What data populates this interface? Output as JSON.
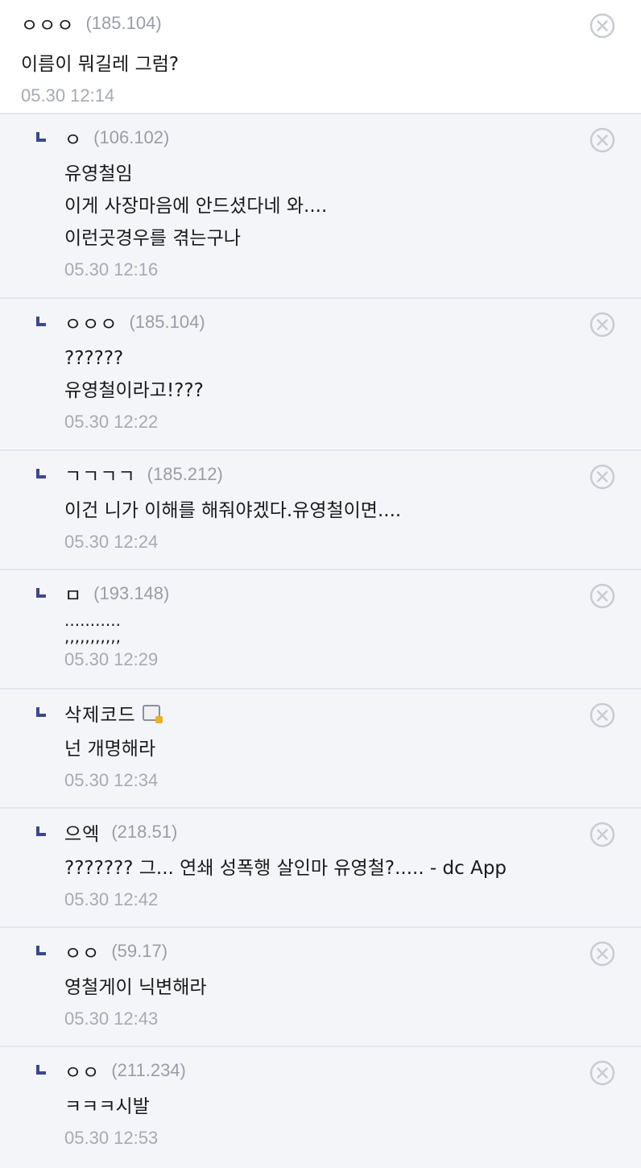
{
  "comments": [
    {
      "nick": "ㅇㅇㅇ",
      "ip": "(185.104)",
      "body": "이름이 뭐길레 그럼?",
      "date": "05.30 12:14",
      "reply": false
    },
    {
      "nick": "ㅇ",
      "ip": "(106.102)",
      "body": "유영철임\n이게 사장마음에 안드셨다네 와....\n이런곳경우를 겪는구나",
      "date": "05.30 12:16",
      "reply": true
    },
    {
      "nick": "ㅇㅇㅇ",
      "ip": "(185.104)",
      "body": "??????\n유영철이라고!???",
      "date": "05.30 12:22",
      "reply": true
    },
    {
      "nick": "ㄱㄱㄱㄱ",
      "ip": "(185.212)",
      "body": "이건 니가 이해를 해줘야겠다.유영철이면....",
      "date": "05.30 12:24",
      "reply": true
    },
    {
      "nick": "ㅁ",
      "ip": "(193.148)",
      "body": "...........\n,,,,,,,,,,,",
      "date": "05.30 12:29",
      "reply": true
    },
    {
      "nick": "삭제코드",
      "ip": "",
      "body": "넌 개명해라",
      "date": "05.30 12:34",
      "reply": true,
      "badge": true
    },
    {
      "nick": "으엑",
      "ip": "(218.51)",
      "body": "??????? 그... 연쇄 성폭행 살인마 유영철?..... - dc App",
      "date": "05.30 12:42",
      "reply": true
    },
    {
      "nick": "ㅇㅇ",
      "ip": "(59.17)",
      "body": "영철게이 닉변해라",
      "date": "05.30 12:43",
      "reply": true
    },
    {
      "nick": "ㅇㅇ",
      "ip": "(211.234)",
      "body": "ㅋㅋㅋ시발",
      "date": "05.30 12:53",
      "reply": true
    }
  ],
  "icons": {
    "delete": "close-circle-icon",
    "reply": "reply-arrow-icon",
    "member_badge": "gallog-badge-icon"
  },
  "colors": {
    "reply_bg": "#f4f5f9",
    "reply_mark": "#3b4890",
    "muted": "#9a9da8"
  }
}
